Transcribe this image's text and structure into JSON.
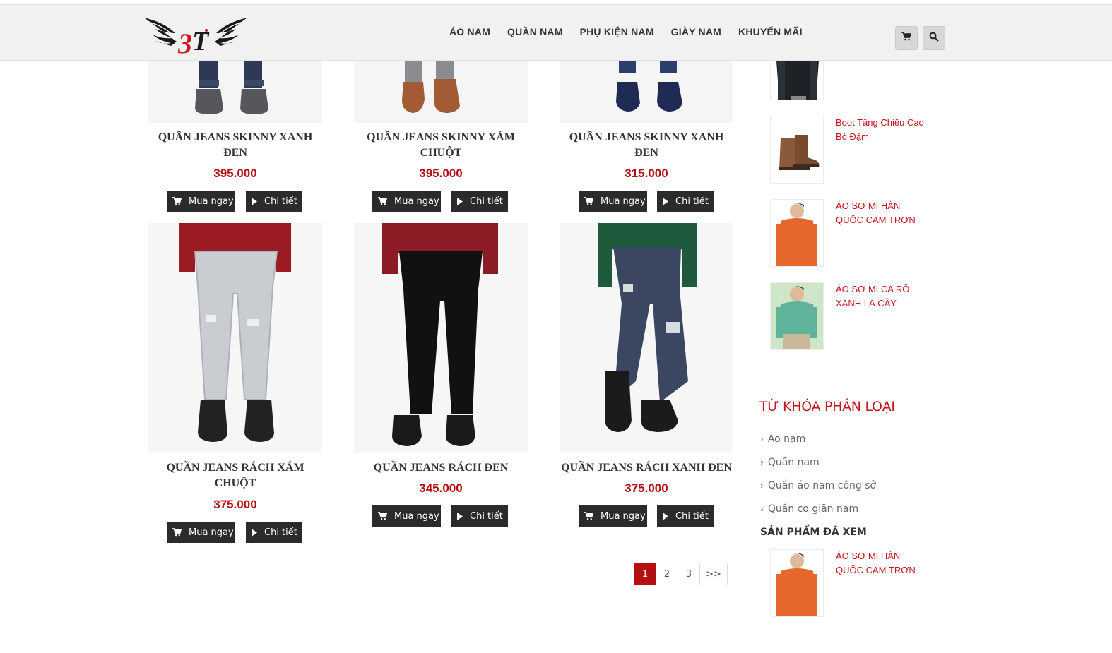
{
  "header": {
    "logo_alt": "3T",
    "nav": [
      "ÁO NAM",
      "QUẦN NAM",
      "PHỤ KIỆN NAM",
      "GIÀY NAM",
      "KHUYẾN MÃI"
    ],
    "cart_icon": "cart-icon",
    "search_icon": "search-icon"
  },
  "products": [
    {
      "name": "QUẦN JEANS SKINNY XANH ĐEN",
      "price": "395.000"
    },
    {
      "name": "QUẦN JEANS SKINNY XÁM CHUỘT",
      "price": "395.000"
    },
    {
      "name": "QUẦN JEANS SKINNY XANH ĐEN",
      "price": "315.000"
    },
    {
      "name": "QUẦN JEANS RÁCH XÁM CHUỘT",
      "price": "375.000"
    },
    {
      "name": "QUẦN JEANS RÁCH ĐEN",
      "price": "345.000"
    },
    {
      "name": "QUẦN JEANS RÁCH XANH ĐEN",
      "price": "375.000"
    }
  ],
  "buttons": {
    "buy": "Mua ngay",
    "detail": "Chi tiết"
  },
  "pagination": {
    "pages": [
      "1",
      "2",
      "3"
    ],
    "next": ">>",
    "current": "1"
  },
  "sidebar": {
    "related": [
      {
        "name": ""
      },
      {
        "name": "Boot Tăng Chiều Cao Bò Đậm"
      },
      {
        "name": "ÁO SƠ MI HÀN QUỐC CAM TRƠN"
      },
      {
        "name": "ÁO SƠ MI CA RÔ XANH LÁ CÂY"
      }
    ],
    "tags_heading": "TỪ KHÓA PHÂN LOẠI",
    "tags": [
      "Áo nam",
      "Quần nam",
      "Quần áo nam công sở",
      "Quần co giãn nam"
    ],
    "viewed_heading": "SẢN PHẨM ĐÃ XEM",
    "viewed": [
      {
        "name": "ÁO SƠ MI HÀN QUỐC CAM TRƠN"
      }
    ]
  },
  "colors": {
    "accent": "#b40f12",
    "link": "#c4161c",
    "button": "#2b2b2b"
  }
}
